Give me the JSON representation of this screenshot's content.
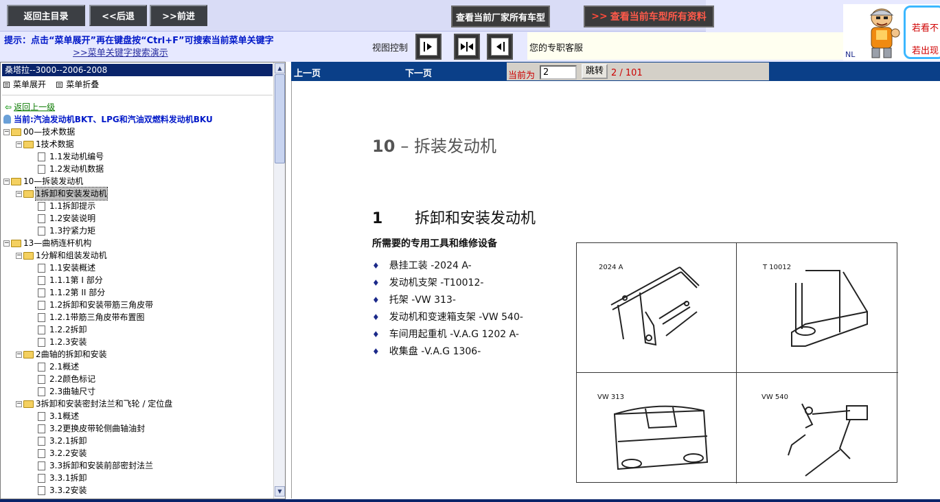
{
  "topbar": {
    "home_label": "返回主目录",
    "back_label": "<<后退",
    "forward_label": ">>前进",
    "maker_models_label": "查看当前厂家所有车型",
    "all_info_arrows": ">>",
    "all_info_label": "查看当前车型所有资料",
    "tip": "提示：点击“菜单展开”再在键盘按“Ctrl+F”可搜索当前菜单关键字",
    "search_demo_link": ">>菜单关键字搜索演示",
    "view_control_label": "视图控制",
    "service_text": "您的专职客服",
    "banner_nl": "NL",
    "ad_line1": "若看不",
    "ad_line2": "若出现"
  },
  "tree": {
    "title": "桑塔拉--3000--2006-2008",
    "expand_label": "菜单展开",
    "collapse_label": "菜单折叠",
    "back_up_label": "返回上一级",
    "current_label": "当前:汽油发动机BKT、LPG和汽油双燃料发动机BKU",
    "nodes": [
      {
        "label": "00—技术数据",
        "type": "folder",
        "level": 0
      },
      {
        "label": "1技术数据",
        "type": "folder",
        "level": 1
      },
      {
        "label": "1.1发动机编号",
        "type": "doc",
        "level": 2
      },
      {
        "label": "1.2发动机数据",
        "type": "doc",
        "level": 2
      },
      {
        "label": "10—拆装发动机",
        "type": "folder",
        "level": 0
      },
      {
        "label": "1拆卸和安装发动机",
        "type": "folder",
        "level": 1,
        "selected": true
      },
      {
        "label": "1.1拆卸提示",
        "type": "doc",
        "level": 2
      },
      {
        "label": "1.2安装说明",
        "type": "doc",
        "level": 2
      },
      {
        "label": "1.3拧紧力矩",
        "type": "doc",
        "level": 2
      },
      {
        "label": "13—曲柄连杆机构",
        "type": "folder",
        "level": 0
      },
      {
        "label": "1分解和组装发动机",
        "type": "folder",
        "level": 1
      },
      {
        "label": "1.1安装概述",
        "type": "doc",
        "level": 2
      },
      {
        "label": "1.1.1第 I 部分",
        "type": "doc",
        "level": 2
      },
      {
        "label": "1.1.2第 II 部分",
        "type": "doc",
        "level": 2
      },
      {
        "label": "1.2拆卸和安装带筋三角皮带",
        "type": "doc",
        "level": 2
      },
      {
        "label": "1.2.1带筋三角皮带布置图",
        "type": "doc",
        "level": 2
      },
      {
        "label": "1.2.2拆卸",
        "type": "doc",
        "level": 2
      },
      {
        "label": "1.2.3安装",
        "type": "doc",
        "level": 2
      },
      {
        "label": "2曲轴的拆卸和安装",
        "type": "folder",
        "level": 1
      },
      {
        "label": "2.1概述",
        "type": "doc",
        "level": 2
      },
      {
        "label": "2.2颜色标记",
        "type": "doc",
        "level": 2
      },
      {
        "label": "2.3曲轴尺寸",
        "type": "doc",
        "level": 2
      },
      {
        "label": "3拆卸和安装密封法兰和飞轮 / 定位盘",
        "type": "folder",
        "level": 1
      },
      {
        "label": "3.1概述",
        "type": "doc",
        "level": 2
      },
      {
        "label": "3.2更换皮带轮侧曲轴油封",
        "type": "doc",
        "level": 2
      },
      {
        "label": "3.2.1拆卸",
        "type": "doc",
        "level": 2
      },
      {
        "label": "3.2.2安装",
        "type": "doc",
        "level": 2
      },
      {
        "label": "3.3拆卸和安装前部密封法兰",
        "type": "doc",
        "level": 2
      },
      {
        "label": "3.3.1拆卸",
        "type": "doc",
        "level": 2
      },
      {
        "label": "3.3.2安装",
        "type": "doc",
        "level": 2
      }
    ]
  },
  "pager": {
    "prev_label": "上一页",
    "next_label": "下一页",
    "current_label": "当前为",
    "current_page": "2",
    "jump_label": "跳转",
    "page_count": "2 / 101"
  },
  "document": {
    "chapter_num": "10",
    "chapter_title": "– 拆装发动机",
    "section_num": "1",
    "section_title": "拆卸和安装发动机",
    "tools_heading": "所需要的专用工具和维修设备",
    "tools": [
      "悬挂工装  -2024 A-",
      "发动机支架  -T10012-",
      "托架  -VW 313-",
      "发动机和变速箱支架  -VW 540-",
      "车间用起重机  -V.A.G 1202 A-",
      "收集盘  -V.A.G 1306-"
    ],
    "tool_images": [
      "2024 A",
      "T 10012",
      "VW 313",
      "VW 540"
    ]
  },
  "colors": {
    "title_bar": "#0a246a",
    "page_bar": "#0a3f88",
    "accent_red": "#cc0000",
    "link_blue": "#0018c8"
  }
}
